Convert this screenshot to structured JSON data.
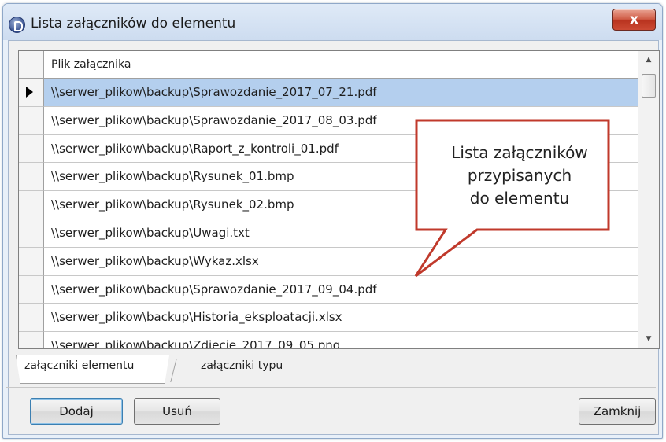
{
  "window": {
    "title": "Lista załączników do elementu",
    "close_label": "x"
  },
  "grid": {
    "column_header": "Plik załącznika",
    "rows": [
      "\\\\serwer_plikow\\backup\\Sprawozdanie_2017_07_21.pdf",
      "\\\\serwer_plikow\\backup\\Sprawozdanie_2017_08_03.pdf",
      "\\\\serwer_plikow\\backup\\Raport_z_kontroli_01.pdf",
      "\\\\serwer_plikow\\backup\\Rysunek_01.bmp",
      "\\\\serwer_plikow\\backup\\Rysunek_02.bmp",
      "\\\\serwer_plikow\\backup\\Uwagi.txt",
      "\\\\serwer_plikow\\backup\\Wykaz.xlsx",
      "\\\\serwer_plikow\\backup\\Sprawozdanie_2017_09_04.pdf",
      "\\\\serwer_plikow\\backup\\Historia_eksploatacji.xlsx",
      "\\\\serwer_plikow\\backup\\Zdjecie_2017_09_05.png"
    ],
    "selected_index": 0,
    "selection_color": "#b4cfee"
  },
  "tabs": {
    "active": "załączniki elementu",
    "inactive": "załączniki typu"
  },
  "buttons": {
    "add": "Dodaj",
    "remove": "Usuń",
    "close": "Zamknij"
  },
  "callout": {
    "line1": "Lista załączników",
    "line2": "przypisanych",
    "line3": "do elementu",
    "border_color": "#c0392b"
  },
  "icons": {
    "app": "app-icon",
    "close": "close-icon",
    "row_pointer": "row-pointer-icon",
    "scroll_up": "scroll-up-icon",
    "scroll_down": "scroll-down-icon"
  }
}
